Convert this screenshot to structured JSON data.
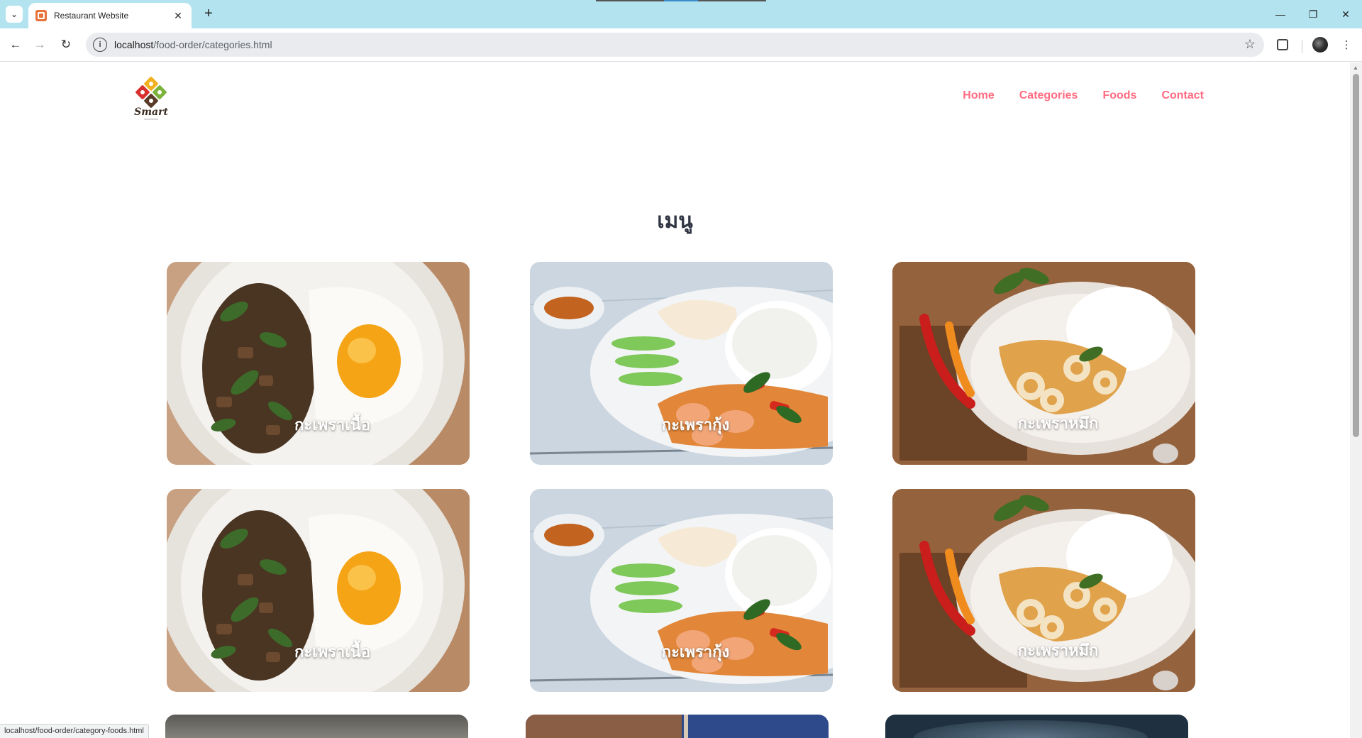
{
  "browser": {
    "tab_title": "Restaurant Website",
    "url_host": "localhost",
    "url_path": "/food-order/categories.html",
    "status_url": "localhost/food-order/category-foods.html"
  },
  "site": {
    "logo_text": "Smart",
    "nav": [
      "Home",
      "Categories",
      "Foods",
      "Contact"
    ],
    "nav_color": "#ff6b81"
  },
  "page": {
    "title": "เมนู",
    "categories": [
      {
        "label": "กะเพราเนื้อ",
        "image": "beef-basil-egg"
      },
      {
        "label": "กะเพรากุ้ง",
        "image": "shrimp-basil-rice"
      },
      {
        "label": "กะเพราหมึก",
        "image": "squid-basil-rice"
      },
      {
        "label": "กะเพราเนื้อ",
        "image": "beef-basil-egg"
      },
      {
        "label": "กะเพรากุ้ง",
        "image": "shrimp-basil-rice"
      },
      {
        "label": "กะเพราหมึก",
        "image": "squid-basil-rice"
      }
    ]
  }
}
